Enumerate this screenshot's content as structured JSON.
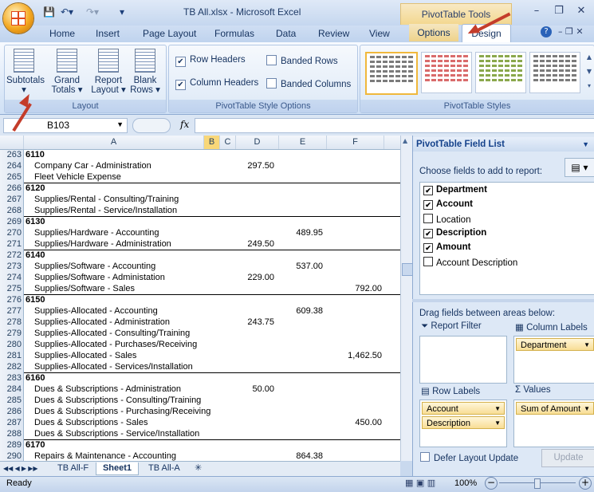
{
  "window": {
    "title": "TB All.xlsx - Microsoft Excel",
    "contextual_tab_group": "PivotTable Tools",
    "qat_icons": [
      "save-icon",
      "undo-icon",
      "redo-icon"
    ]
  },
  "tabs": [
    "Home",
    "Insert",
    "Page Layout",
    "Formulas",
    "Data",
    "Review",
    "View",
    "Options",
    "Design"
  ],
  "ribbon": {
    "layout_group": {
      "label": "Layout",
      "buttons": [
        {
          "line1": "Subtotals",
          "line2": "▾"
        },
        {
          "line1": "Grand",
          "line2": "Totals ▾"
        },
        {
          "line1": "Report",
          "line2": "Layout ▾"
        },
        {
          "line1": "Blank",
          "line2": "Rows ▾"
        }
      ]
    },
    "style_options_group": {
      "label": "PivotTable Style Options",
      "row_headers": "Row Headers",
      "column_headers": "Column Headers",
      "banded_rows": "Banded Rows",
      "banded_columns": "Banded Columns"
    },
    "styles_group": {
      "label": "PivotTable Styles"
    }
  },
  "formula_bar": {
    "name_box": "B103",
    "fx": "fx",
    "formula": ""
  },
  "columns": [
    "A",
    "B",
    "C",
    "D",
    "E",
    "F"
  ],
  "rows": [
    {
      "n": "263",
      "a": "6110",
      "bold": true,
      "d": "",
      "e": "",
      "f": ""
    },
    {
      "n": "264",
      "a": "Company Car - Administration",
      "bold": false,
      "d": "297.50",
      "e": "",
      "f": ""
    },
    {
      "n": "265",
      "a": "Fleet Vehicle Expense",
      "bold": false,
      "d": "",
      "e": "",
      "f": ""
    },
    {
      "n": "266",
      "a": "6120",
      "bold": true,
      "d": "",
      "e": "",
      "f": ""
    },
    {
      "n": "267",
      "a": "Supplies/Rental - Consulting/Training",
      "bold": false,
      "d": "",
      "e": "",
      "f": ""
    },
    {
      "n": "268",
      "a": "Supplies/Rental - Service/Installation",
      "bold": false,
      "d": "",
      "e": "",
      "f": ""
    },
    {
      "n": "269",
      "a": "6130",
      "bold": true,
      "d": "",
      "e": "",
      "f": ""
    },
    {
      "n": "270",
      "a": "Supplies/Hardware - Accounting",
      "bold": false,
      "d": "",
      "e": "489.95",
      "f": ""
    },
    {
      "n": "271",
      "a": "Supplies/Hardware - Administration",
      "bold": false,
      "d": "249.50",
      "e": "",
      "f": ""
    },
    {
      "n": "272",
      "a": "6140",
      "bold": true,
      "d": "",
      "e": "",
      "f": ""
    },
    {
      "n": "273",
      "a": "Supplies/Software - Accounting",
      "bold": false,
      "d": "",
      "e": "537.00",
      "f": ""
    },
    {
      "n": "274",
      "a": "Supplies/Software - Administation",
      "bold": false,
      "d": "229.00",
      "e": "",
      "f": ""
    },
    {
      "n": "275",
      "a": "Supplies/Software - Sales",
      "bold": false,
      "d": "",
      "e": "",
      "f": "792.00"
    },
    {
      "n": "276",
      "a": "6150",
      "bold": true,
      "d": "",
      "e": "",
      "f": ""
    },
    {
      "n": "277",
      "a": "Supplies-Allocated - Accounting",
      "bold": false,
      "d": "",
      "e": "609.38",
      "f": ""
    },
    {
      "n": "278",
      "a": "Supplies-Allocated - Administration",
      "bold": false,
      "d": "243.75",
      "e": "",
      "f": ""
    },
    {
      "n": "279",
      "a": "Supplies-Allocated - Consulting/Training",
      "bold": false,
      "d": "",
      "e": "",
      "f": ""
    },
    {
      "n": "280",
      "a": "Supplies-Allocated - Purchases/Receiving",
      "bold": false,
      "d": "",
      "e": "",
      "f": ""
    },
    {
      "n": "281",
      "a": "Supplies-Allocated - Sales",
      "bold": false,
      "d": "",
      "e": "",
      "f": "1,462.50"
    },
    {
      "n": "282",
      "a": "Supplies-Allocated - Services/Installation",
      "bold": false,
      "d": "",
      "e": "",
      "f": ""
    },
    {
      "n": "283",
      "a": "6160",
      "bold": true,
      "d": "",
      "e": "",
      "f": ""
    },
    {
      "n": "284",
      "a": "Dues & Subscriptions - Administration",
      "bold": false,
      "d": "50.00",
      "e": "",
      "f": ""
    },
    {
      "n": "285",
      "a": "Dues & Subscriptions - Consulting/Training",
      "bold": false,
      "d": "",
      "e": "",
      "f": ""
    },
    {
      "n": "286",
      "a": "Dues & Subscriptions - Purchasing/Receiving",
      "bold": false,
      "d": "",
      "e": "",
      "f": ""
    },
    {
      "n": "287",
      "a": "Dues & Subscriptions - Sales",
      "bold": false,
      "d": "",
      "e": "",
      "f": "450.00"
    },
    {
      "n": "288",
      "a": "Dues & Subscriptions - Service/Installation",
      "bold": false,
      "d": "",
      "e": "",
      "f": ""
    },
    {
      "n": "289",
      "a": "6170",
      "bold": true,
      "d": "",
      "e": "",
      "f": ""
    },
    {
      "n": "290",
      "a": "Repairs & Maintenance - Accounting",
      "bold": false,
      "d": "",
      "e": "864.38",
      "f": ""
    }
  ],
  "sheet_tabs": [
    "TB All-F",
    "Sheet1",
    "TB All-A"
  ],
  "field_list": {
    "title": "PivotTable Field List",
    "choose_label": "Choose fields to add to report:",
    "fields": [
      {
        "name": "Department",
        "checked": true
      },
      {
        "name": "Account",
        "checked": true
      },
      {
        "name": "Location",
        "checked": false
      },
      {
        "name": "Description",
        "checked": true
      },
      {
        "name": "Amount",
        "checked": true
      },
      {
        "name": "Account Description",
        "checked": false
      }
    ],
    "drag_label": "Drag fields between areas below:",
    "report_filter": "Report Filter",
    "column_labels": "Column Labels",
    "row_labels": "Row Labels",
    "values": "Values",
    "column_items": [
      "Department"
    ],
    "row_items": [
      "Account",
      "Description"
    ],
    "value_items": [
      "Sum of Amount"
    ],
    "defer_label": "Defer Layout Update",
    "update_label": "Update"
  },
  "status": {
    "ready": "Ready",
    "zoom": "100%"
  }
}
